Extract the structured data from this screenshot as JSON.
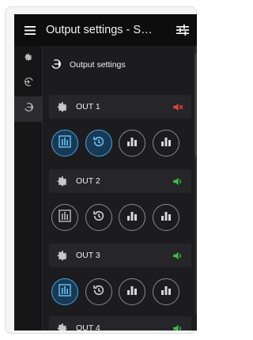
{
  "header": {
    "title": "Output settings - S…",
    "menu_icon": "hamburger-menu-icon",
    "tune_icon": "tune-sliders-icon"
  },
  "sidebar": {
    "items": [
      {
        "icon": "gear-icon",
        "active": false
      },
      {
        "icon": "input-arrow-icon",
        "active": false
      },
      {
        "icon": "output-arrow-icon",
        "active": true
      }
    ]
  },
  "section": {
    "title": "Output settings",
    "icon": "output-arrow-icon"
  },
  "colors": {
    "accent_blue": "#4aa3e0",
    "muted_red": "#e0443c",
    "active_green": "#3fbf4a"
  },
  "outputs": [
    {
      "name": "OUT 1",
      "speaker": "muted",
      "buttons": [
        true,
        true,
        false,
        false
      ]
    },
    {
      "name": "OUT 2",
      "speaker": "on",
      "buttons": [
        false,
        false,
        false,
        false
      ]
    },
    {
      "name": "OUT 3",
      "speaker": "on",
      "buttons": [
        true,
        false,
        false,
        false
      ]
    },
    {
      "name": "OUT 4",
      "speaker": "on",
      "buttons": []
    }
  ],
  "button_icons": [
    "level-meter-icon",
    "delay-clock-icon",
    "equalizer-bars-icon",
    "equalizer-bars-icon"
  ]
}
